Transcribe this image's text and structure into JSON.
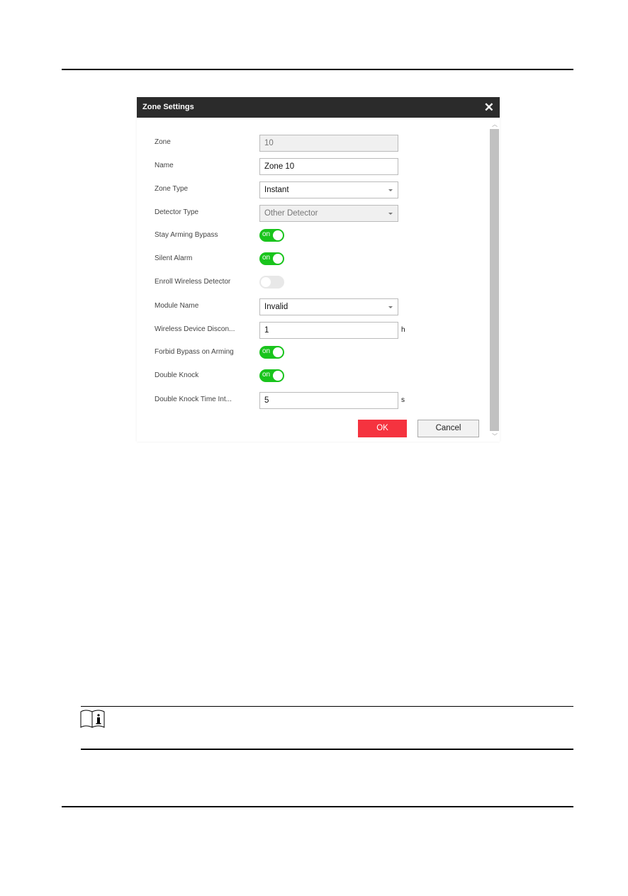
{
  "dialog": {
    "title": "Zone Settings",
    "close_icon": "close-icon",
    "fields": [
      {
        "label": "Zone",
        "type": "input",
        "value": "10",
        "disabled": true
      },
      {
        "label": "Name",
        "type": "input",
        "value": "Zone 10"
      },
      {
        "label": "Zone Type",
        "type": "select",
        "value": "Instant"
      },
      {
        "label": "Detector Type",
        "type": "select",
        "value": "Other Detector",
        "disabled": true
      },
      {
        "label": "Stay Arming Bypass",
        "type": "toggle",
        "on": true,
        "text": "on"
      },
      {
        "label": "Silent Alarm",
        "type": "toggle",
        "on": true,
        "text": "on"
      },
      {
        "label": "Enroll Wireless Detector",
        "type": "toggle",
        "on": false,
        "text": ""
      },
      {
        "label": "Module Name",
        "type": "select",
        "value": "Invalid"
      },
      {
        "label": "Wireless Device Discon...",
        "type": "input",
        "value": "1",
        "unit": "h"
      },
      {
        "label": "Forbid Bypass on Arming",
        "type": "toggle",
        "on": true,
        "text": "on"
      },
      {
        "label": "Double Knock",
        "type": "toggle",
        "on": true,
        "text": "on"
      },
      {
        "label": "Double Knock Time Int...",
        "type": "input",
        "value": "5",
        "unit": "s"
      }
    ],
    "ok_label": "OK",
    "cancel_label": "Cancel",
    "colors": {
      "header": "#2b2b2b",
      "toggle_on": "#19c41c",
      "ok": "#f5333f"
    }
  },
  "note": {
    "icon": "info-book-icon"
  }
}
